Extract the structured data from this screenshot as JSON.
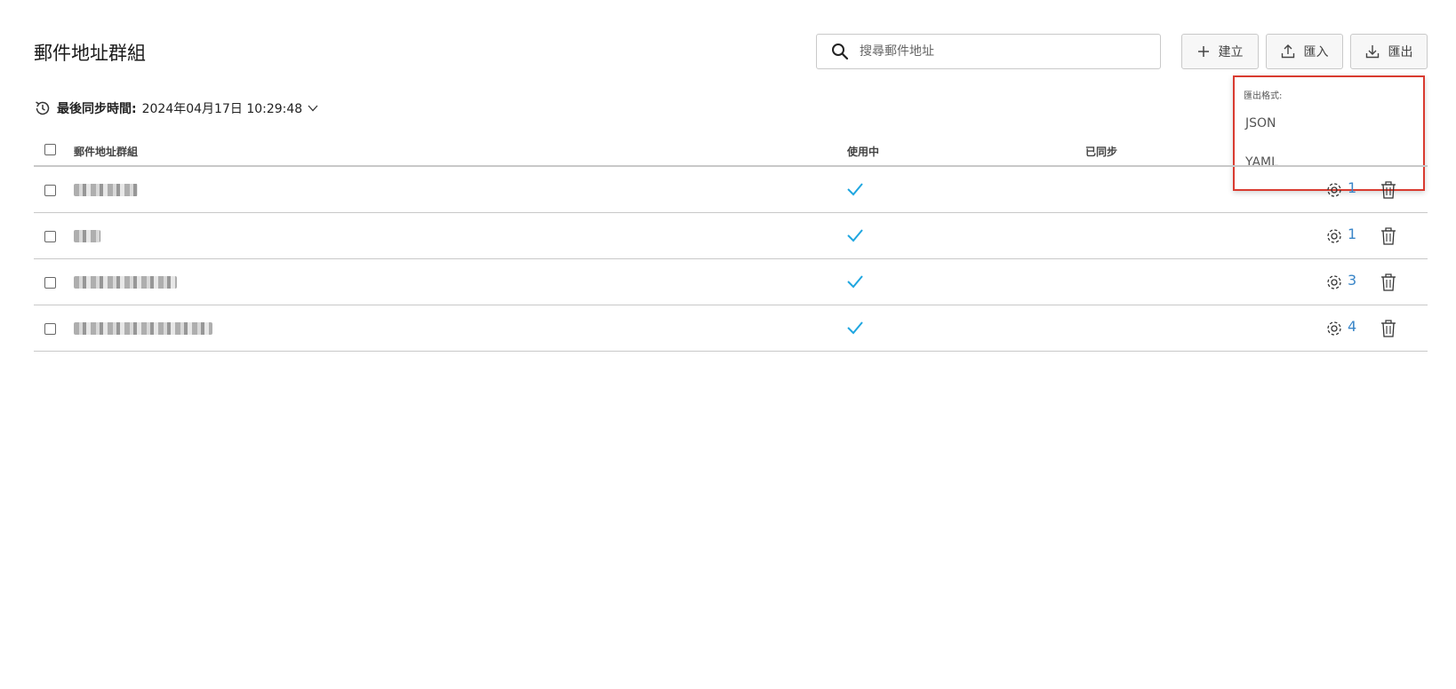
{
  "header": {
    "title": "郵件地址群組"
  },
  "search": {
    "placeholder": "搜尋郵件地址"
  },
  "toolbar": {
    "create_label": "建立",
    "import_label": "匯入",
    "export_label": "匯出"
  },
  "export_menu": {
    "label": "匯出格式:",
    "options": [
      "JSON",
      "YAML"
    ]
  },
  "sync": {
    "label": "最後同步時間:",
    "value": "2024年04月17日 10:29:48"
  },
  "table": {
    "columns": [
      "郵件地址群組",
      "使用中",
      "已同步"
    ],
    "rows": [
      {
        "active": true,
        "count": "1"
      },
      {
        "active": true,
        "count": "1"
      },
      {
        "active": true,
        "count": "3"
      },
      {
        "active": true,
        "count": "4"
      }
    ]
  },
  "colors": {
    "accent": "#3a86c8",
    "check": "#1fa6e0",
    "highlight_border": "#d93b30"
  }
}
